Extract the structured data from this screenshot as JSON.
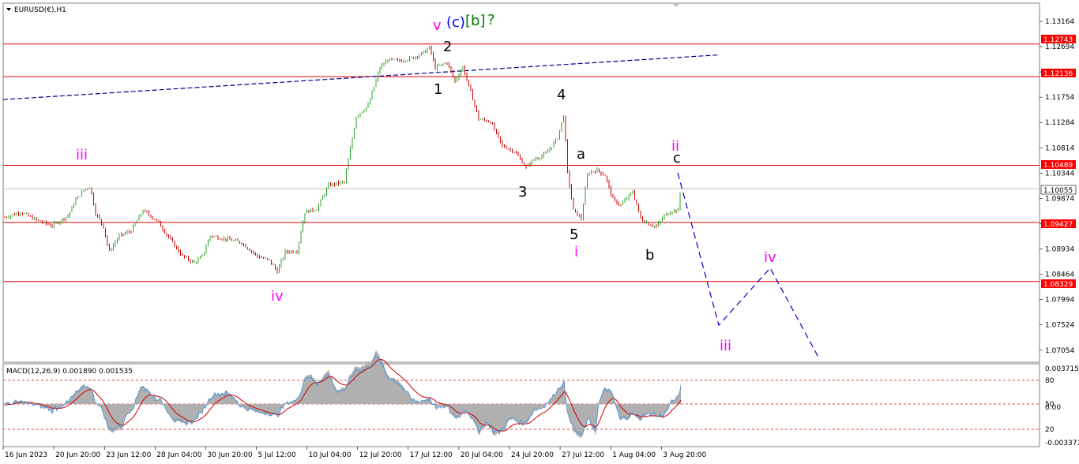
{
  "window": {
    "title": "EURUSD(€),H1",
    "indicator_title": "MACD(12,26,9) 0.001890 0.001535"
  },
  "chart_data": [
    {
      "type": "candlestick",
      "symbol": "EURUSD(€)",
      "timeframe": "H1",
      "title": "EURUSD(€),H1",
      "ylim": [
        1.06904,
        1.13164
      ],
      "y_ticks": [
        "1.13164",
        "1.12694",
        "1.12224",
        "1.11754",
        "1.11284",
        "1.10814",
        "1.10344",
        "1.09874",
        "1.09404",
        "1.08934",
        "1.08464",
        "1.07994",
        "1.07524",
        "1.07054"
      ],
      "x_ticks": [
        "16 Jun 2023",
        "20 Jun 20:00",
        "23 Jun 12:00",
        "28 Jun 04:00",
        "30 Jun 20:00",
        "5 Jul 12:00",
        "10 Jul 04:00",
        "12 Jul 20:00",
        "17 Jul 12:00",
        "20 Jul 04:00",
        "24 Jul 20:00",
        "27 Jul 12:00",
        "1 Aug 04:00",
        "3 Aug 20:00"
      ],
      "series": [
        {
          "path_x": [
            0,
            20,
            40,
            60,
            80,
            90,
            100,
            108,
            115,
            125,
            132,
            145,
            160,
            175,
            185,
            195,
            210,
            225,
            240,
            250,
            260,
            280,
            300,
            320,
            335,
            345,
            355,
            370,
            380,
            395,
            410,
            430,
            445,
            460,
            475,
            485,
            500,
            515,
            530,
            538,
            545,
            560,
            570,
            580,
            592,
            600,
            615,
            630,
            645,
            660,
            670,
            685,
            700,
            708,
            712,
            720,
            730,
            738,
            750,
            760,
            770,
            780,
            795,
            805,
            815,
            825,
            835,
            845,
            853,
            858,
            862
          ],
          "path_close": [
            1.0952,
            1.0962,
            1.0947,
            1.0937,
            1.0955,
            1.0985,
            1.1003,
            1.101,
            1.096,
            1.0935,
            1.0888,
            1.0918,
            1.0927,
            1.0965,
            1.0955,
            1.0942,
            1.091,
            1.088,
            1.0868,
            1.088,
            1.0918,
            1.0912,
            1.0905,
            1.088,
            1.0872,
            1.0852,
            1.0888,
            1.089,
            1.0962,
            1.0968,
            1.1012,
            1.1018,
            1.114,
            1.116,
            1.123,
            1.1245,
            1.1243,
            1.1248,
            1.1258,
            1.1268,
            1.123,
            1.124,
            1.1205,
            1.1232,
            1.1175,
            1.1135,
            1.113,
            1.1085,
            1.1075,
            1.1045,
            1.106,
            1.107,
            1.11,
            1.1145,
            1.104,
            1.0965,
            1.095,
            1.1035,
            1.104,
            1.103,
            1.0985,
            1.0975,
            1.1,
            1.095,
            1.094,
            1.0935,
            1.0955,
            1.0965,
            1.0965,
            1.1045,
            1.1005
          ]
        }
      ],
      "horizontal_levels": [
        "1.12743",
        "1.12136",
        "1.10489",
        "1.09427",
        "1.08329"
      ],
      "current_price": "1.10055",
      "wave_labels": [
        {
          "text": "v",
          "color": "#ff00ff"
        },
        {
          "text": "(c)",
          "color": "#0000ff"
        },
        {
          "text": "[b]",
          "color": "#008000"
        },
        {
          "text": "?",
          "color": "#008000"
        },
        {
          "text": "2",
          "color": "#000000"
        },
        {
          "text": "1",
          "color": "#000000"
        },
        {
          "text": "4",
          "color": "#000000"
        },
        {
          "text": "3",
          "color": "#000000"
        },
        {
          "text": "5",
          "color": "#000000"
        },
        {
          "text": "i",
          "color": "#ff00ff"
        },
        {
          "text": "a",
          "color": "#000000"
        },
        {
          "text": "b",
          "color": "#000000"
        },
        {
          "text": "c",
          "color": "#000000"
        },
        {
          "text": "ii",
          "color": "#ff00ff"
        },
        {
          "text": "iii",
          "color": "#ff00ff"
        },
        {
          "text": "iii",
          "color": "#ff00ff"
        },
        {
          "text": "iv",
          "color": "#ff00ff"
        },
        {
          "text": "iv",
          "color": "#ff00ff"
        }
      ],
      "projection": {
        "color": "#0000cc",
        "labels": [
          "iii",
          "iv"
        ]
      }
    },
    {
      "type": "line",
      "name": "MACD(12,26,9)",
      "values_text": "0.001890 0.001535",
      "y_ticks": [
        "0.003715",
        "80",
        "50",
        "0.00",
        "20",
        "-0.003373"
      ],
      "levels": [
        80,
        50,
        20
      ]
    }
  ],
  "colors": {
    "up": "#2ca02c",
    "down": "#cc0000",
    "level_line": "#dd0000",
    "level_label_bg": "#ff0000",
    "current_label_bg": "#ffffff",
    "trendline": "#00008b",
    "macd_hist": "#b0b0b0",
    "macd_signal": "#cc0000",
    "macd_main": "#3d8fe0"
  }
}
